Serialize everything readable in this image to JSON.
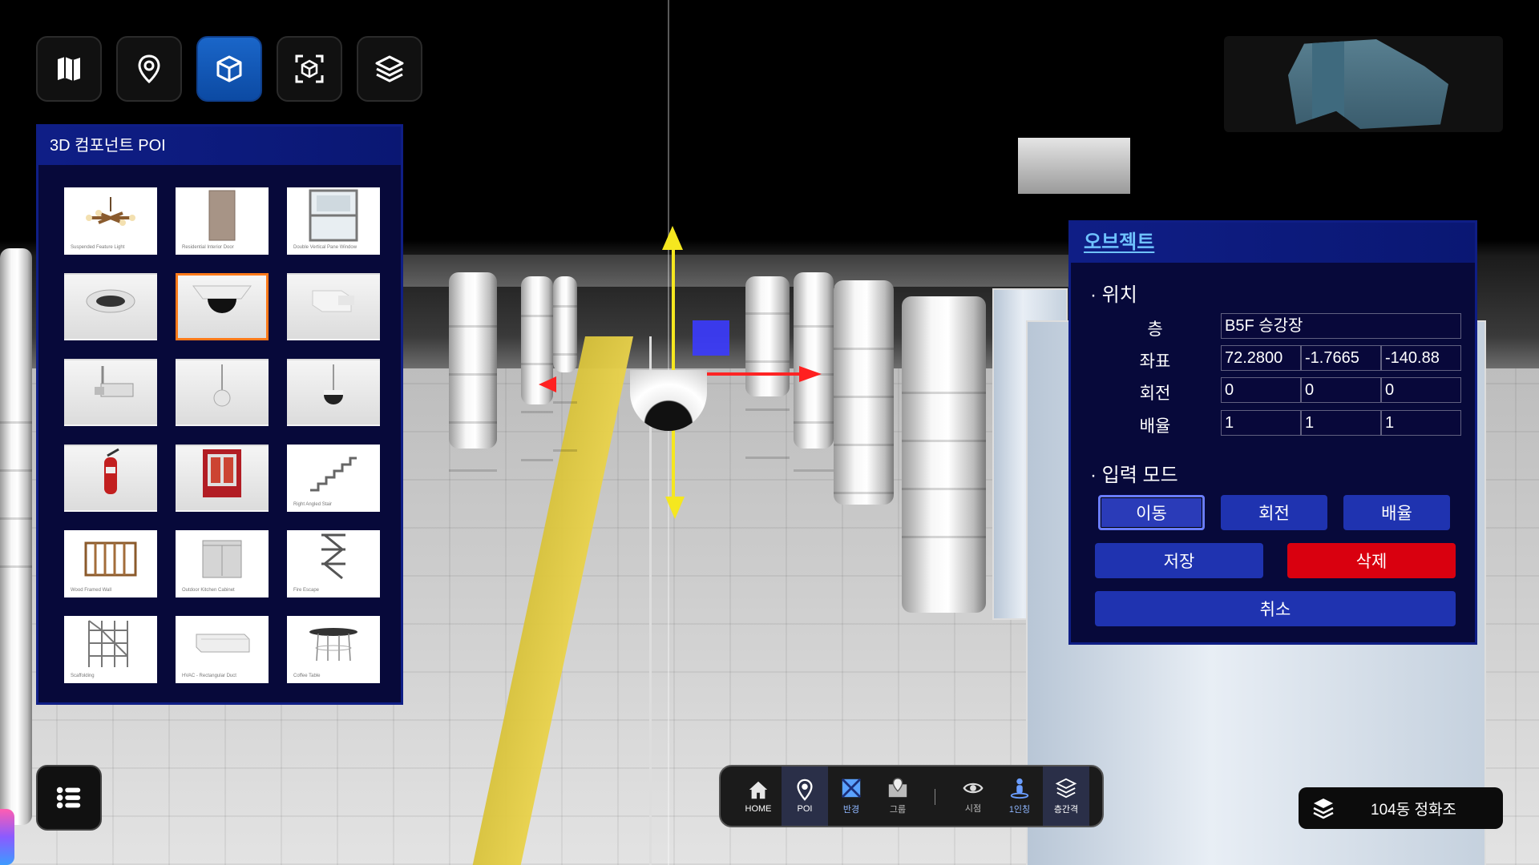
{
  "toolbar": {
    "buttons": [
      {
        "icon": "map-icon",
        "active": false
      },
      {
        "icon": "location-pin-icon",
        "active": false
      },
      {
        "icon": "cube-icon",
        "active": true
      },
      {
        "icon": "scan-cube-icon",
        "active": false
      },
      {
        "icon": "layers-icon",
        "active": false
      }
    ]
  },
  "poi_panel": {
    "title": "3D 컴포넌트 POI",
    "items": [
      {
        "caption": "Suspended Feature Light",
        "shape": "chandelier",
        "selected": false
      },
      {
        "caption": "Residential Interior Door",
        "shape": "door",
        "selected": false
      },
      {
        "caption": "Double Vertical Pane Window",
        "shape": "window",
        "selected": false
      },
      {
        "caption": "",
        "shape": "ceiling-light",
        "selected": false
      },
      {
        "caption": "",
        "shape": "dome-camera",
        "selected": true
      },
      {
        "caption": "",
        "shape": "box-camera",
        "selected": false
      },
      {
        "caption": "",
        "shape": "wall-camera",
        "selected": false
      },
      {
        "caption": "",
        "shape": "pendant-camera",
        "selected": false
      },
      {
        "caption": "",
        "shape": "hanging-dome",
        "selected": false
      },
      {
        "caption": "",
        "shape": "extinguisher",
        "selected": false
      },
      {
        "caption": "",
        "shape": "fire-cabinet",
        "selected": false
      },
      {
        "caption": "Right Angled Stair",
        "shape": "stair",
        "selected": false
      },
      {
        "caption": "Wood Framed Wall",
        "shape": "wood-wall",
        "selected": false
      },
      {
        "caption": "Outdoor Kitchen Cabinet",
        "shape": "cabinet",
        "selected": false
      },
      {
        "caption": "Fire Escape",
        "shape": "fire-escape",
        "selected": false
      },
      {
        "caption": "Scaffolding",
        "shape": "scaffolding",
        "selected": false
      },
      {
        "caption": "HVAC - Rectangular Duct",
        "shape": "duct",
        "selected": false
      },
      {
        "caption": "Coffee Table",
        "shape": "table",
        "selected": false
      }
    ]
  },
  "object_panel": {
    "title": "오브젝트",
    "position_section": "· 위치",
    "floor_label": "층",
    "floor_value": "B5F 승강장",
    "coord_label": "좌표",
    "coord": [
      "72.2800",
      "-1.7665",
      "-140.88"
    ],
    "rotation_label": "회전",
    "rotation": [
      "0",
      "0",
      "0"
    ],
    "scale_label": "배율",
    "scale": [
      "1",
      "1",
      "1"
    ],
    "input_mode_section": "· 입력 모드",
    "mode_buttons": {
      "move": "이동",
      "rotate": "회전",
      "scale": "배율"
    },
    "active_mode": "이동",
    "save": "저장",
    "delete": "삭제",
    "cancel": "취소"
  },
  "dock": {
    "items": [
      {
        "label": "HOME",
        "icon": "home-icon"
      },
      {
        "label": "POI",
        "icon": "poi-pin-icon",
        "active": true
      },
      {
        "label": "반경",
        "icon": "radius-icon"
      },
      {
        "label": "그룹",
        "icon": "group-icon"
      },
      {
        "label": "시점",
        "icon": "eye-icon"
      },
      {
        "label": "1인칭",
        "icon": "first-person-icon"
      },
      {
        "label": "층간격",
        "icon": "floor-gap-icon"
      }
    ]
  },
  "floor_indicator": {
    "label": "104동 정화조",
    "icon": "layers-icon"
  },
  "colors": {
    "panel_bg": "#07093a",
    "panel_header": "#0f1e86",
    "accent": "#1a66c9",
    "danger": "#d9000f",
    "selection": "#ff7a1a"
  }
}
